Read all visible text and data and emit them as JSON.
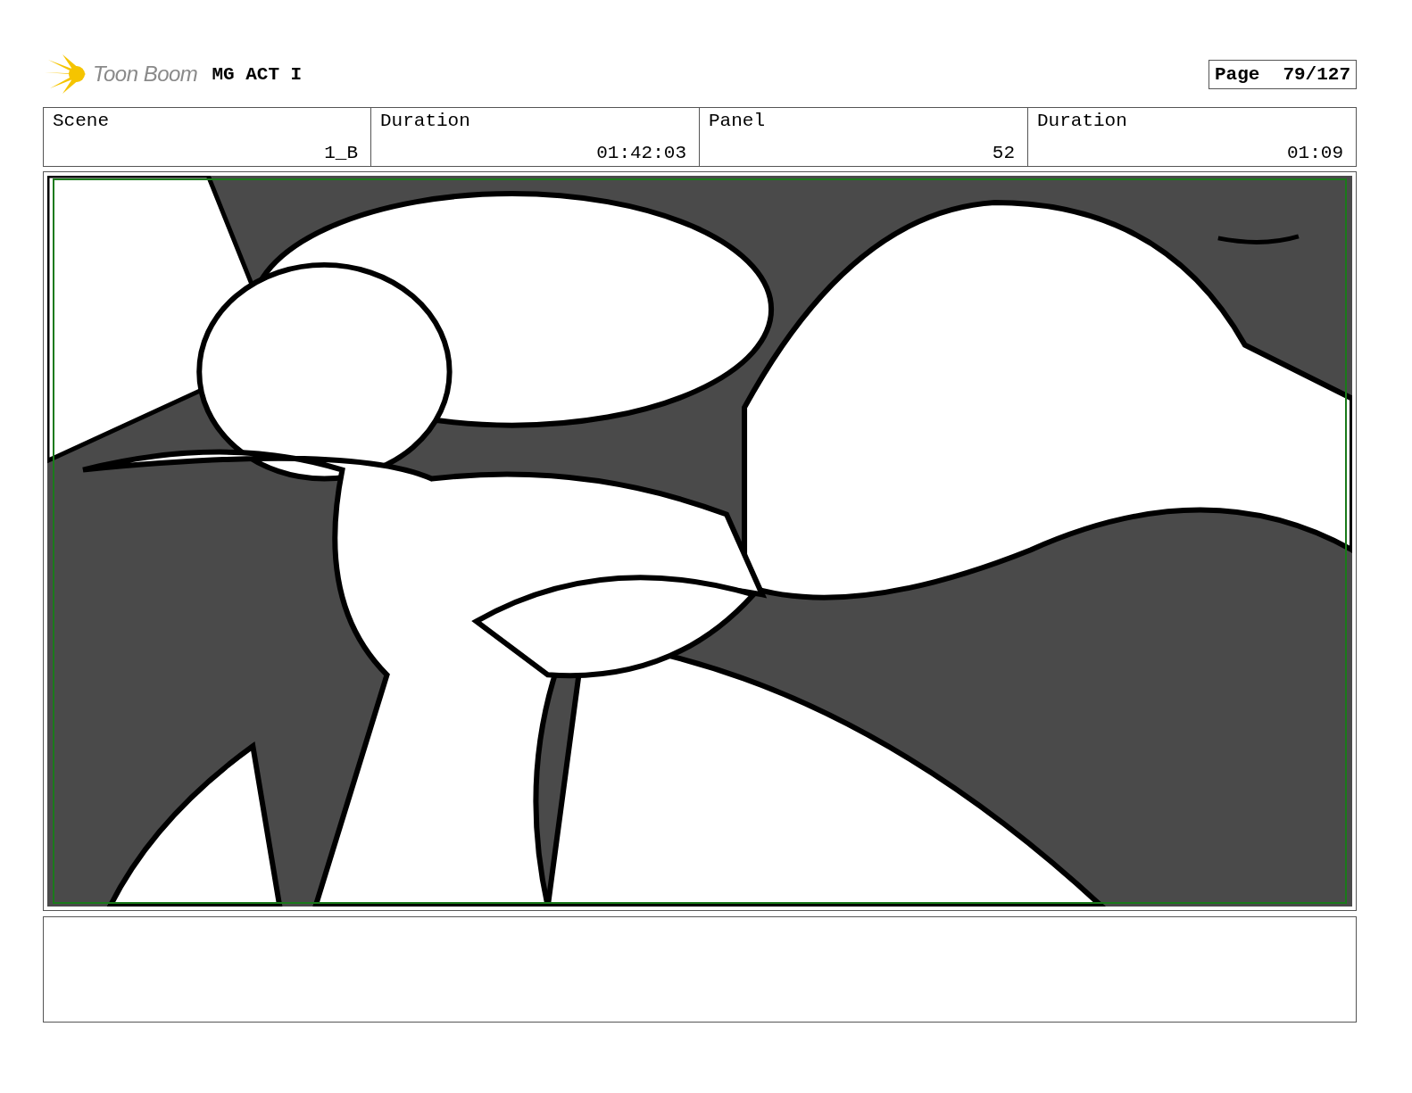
{
  "header": {
    "logo_text": "Toon Boom",
    "project_title": "MG ACT I",
    "page_label": "Page",
    "page_number": "79/127"
  },
  "fields": [
    {
      "label": "Scene",
      "value": "1_B"
    },
    {
      "label": "Duration",
      "value": "01:42:03"
    },
    {
      "label": "Panel",
      "value": "52"
    },
    {
      "label": "Duration",
      "value": "01:09"
    }
  ]
}
